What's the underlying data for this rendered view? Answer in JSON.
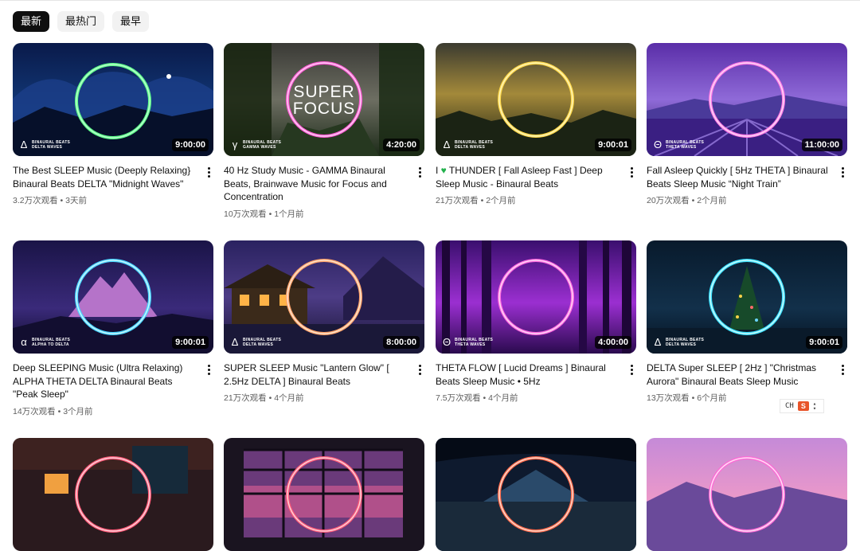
{
  "chips": [
    {
      "label": "最新",
      "active": true
    },
    {
      "label": "最热门",
      "active": false
    },
    {
      "label": "最早",
      "active": false
    }
  ],
  "videos": [
    {
      "title": "The Best SLEEP Music (Deeply Relaxing} Binaural Beats DELTA \"Midnight Waves\"",
      "views": "3.2万次观看",
      "age": "3天前",
      "duration": "9:00:00",
      "brand_line1": "BINAURAL BEATS",
      "brand_line2": "DELTA WAVES",
      "brand_symbol": "Δ"
    },
    {
      "title": "40 Hz Study Music - GAMMA Binaural Beats, Brainwave Music for Focus and Concentration",
      "views": "10万次观看",
      "age": "1个月前",
      "duration": "4:20:00",
      "brand_line1": "BINAURAL BEATS",
      "brand_line2": "GAMMA WAVES",
      "brand_symbol": "γ",
      "overlay_line1": "SUPER",
      "overlay_line2": "FOCUS"
    },
    {
      "title_pre": "I ",
      "title_post": " THUNDER [ Fall Asleep Fast ] Deep Sleep Music - Binaural Beats",
      "heart": "♥",
      "views": "21万次观看",
      "age": "2个月前",
      "duration": "9:00:01",
      "brand_line1": "BINAURAL BEATS",
      "brand_line2": "DELTA WAVES",
      "brand_symbol": "Δ"
    },
    {
      "title": "Fall Asleep Quickly [ 5Hz THETA ] Binaural Beats Sleep Music “Night Train”",
      "views": "20万次观看",
      "age": "2个月前",
      "duration": "11:00:00",
      "brand_line1": "BINAURAL BEATS",
      "brand_line2": "THETA WAVES",
      "brand_symbol": "Θ"
    },
    {
      "title": "Deep SLEEPING Music (Ultra Relaxing) ALPHA THETA DELTA Binaural Beats \"Peak Sleep\"",
      "views": "14万次观看",
      "age": "3个月前",
      "duration": "9:00:01",
      "brand_line1": "BINAURAL BEATS",
      "brand_line2": "ALPHA TO DELTA",
      "brand_symbol": "α"
    },
    {
      "title": "SUPER SLEEP Music \"Lantern Glow\" [ 2.5Hz DELTA ] Binaural Beats",
      "views": "21万次观看",
      "age": "4个月前",
      "duration": "8:00:00",
      "brand_line1": "BINAURAL BEATS",
      "brand_line2": "DELTA WAVES",
      "brand_symbol": "Δ"
    },
    {
      "title": "THETA FLOW [ Lucid Dreams ] Binaural Beats Sleep Music • 5Hz",
      "views": "7.5万次观看",
      "age": "4个月前",
      "duration": "4:00:00",
      "brand_line1": "BINAURAL BEATS",
      "brand_line2": "THETA WAVES",
      "brand_symbol": "Θ"
    },
    {
      "title": "DELTA Super SLEEP [ 2Hz ] \"Christmas Aurora\" Binaural Beats Sleep Music",
      "views": "13万次观看",
      "age": "6个月前",
      "duration": "9:00:01",
      "brand_line1": "BINAURAL BEATS",
      "brand_line2": "DELTA WAVES",
      "brand_symbol": "Δ"
    }
  ],
  "meta_separator": "•",
  "ime": {
    "label": "CH",
    "badge": "S"
  }
}
